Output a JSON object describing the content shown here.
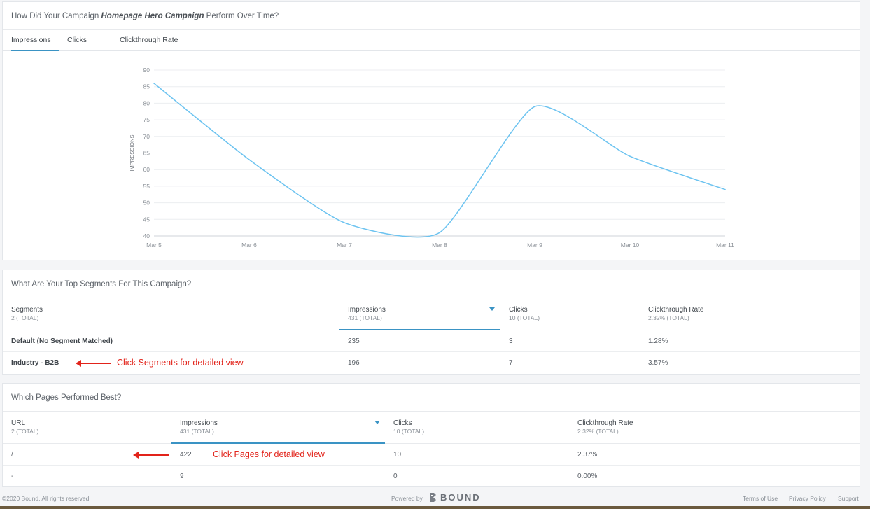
{
  "chart_card": {
    "title_prefix": "How Did Your Campaign ",
    "campaign_name": "Homepage Hero Campaign",
    "title_suffix": " Perform Over Time?",
    "tabs": [
      {
        "label": "Impressions",
        "active": true
      },
      {
        "label": "Clicks",
        "active": false
      },
      {
        "label": "Clickthrough Rate",
        "active": false
      }
    ]
  },
  "chart_data": {
    "type": "line",
    "x": [
      "Mar 5",
      "Mar 6",
      "Mar 7",
      "Mar 8",
      "Mar 9",
      "Mar 10",
      "Mar 11"
    ],
    "series": [
      {
        "values": [
          86,
          63,
          44,
          41,
          79,
          64,
          54
        ]
      }
    ],
    "ylabel": "IMPRESSIONS",
    "ylim": [
      40,
      90
    ],
    "yticks": [
      40,
      45,
      50,
      55,
      60,
      65,
      70,
      75,
      80,
      85,
      90
    ],
    "grid": true,
    "line_color": "#6cc3f0"
  },
  "segments_card": {
    "title": "What Are Your Top Segments For This Campaign?",
    "columns": [
      {
        "header": "Segments",
        "sub": "2 (TOTAL)"
      },
      {
        "header": "Impressions",
        "sub": "431 (TOTAL)"
      },
      {
        "header": "Clicks",
        "sub": "10 (TOTAL)"
      },
      {
        "header": "Clickthrough Rate",
        "sub": "2.32% (TOTAL)"
      }
    ],
    "rows": [
      {
        "name": "Default (No Segment Matched)",
        "impressions": "235",
        "clicks": "3",
        "ctr": "1.28%"
      },
      {
        "name": "Industry - B2B",
        "impressions": "196",
        "clicks": "7",
        "ctr": "3.57%"
      }
    ],
    "annotation": "Click Segments for detailed view"
  },
  "pages_card": {
    "title": "Which Pages Performed Best?",
    "columns": [
      {
        "header": "URL",
        "sub": "2 (TOTAL)"
      },
      {
        "header": "Impressions",
        "sub": "431 (TOTAL)"
      },
      {
        "header": "Clicks",
        "sub": "10 (TOTAL)"
      },
      {
        "header": "Clickthrough Rate",
        "sub": "2.32% (TOTAL)"
      }
    ],
    "rows": [
      {
        "url": "/",
        "impressions": "422",
        "clicks": "10",
        "ctr": "2.37%"
      },
      {
        "url": "-",
        "impressions": "9",
        "clicks": "0",
        "ctr": "0.00%"
      }
    ],
    "annotation": "Click Pages for detailed view"
  },
  "footer": {
    "copyright": "©2020 Bound. All rights reserved.",
    "powered_by": "Powered by",
    "brand": "BOUND",
    "links": [
      "Terms of Use",
      "Privacy Policy",
      "Support"
    ]
  },
  "colors": {
    "accent": "#3a93c4",
    "line": "#6cc3f0",
    "annotation": "#e2231a"
  }
}
